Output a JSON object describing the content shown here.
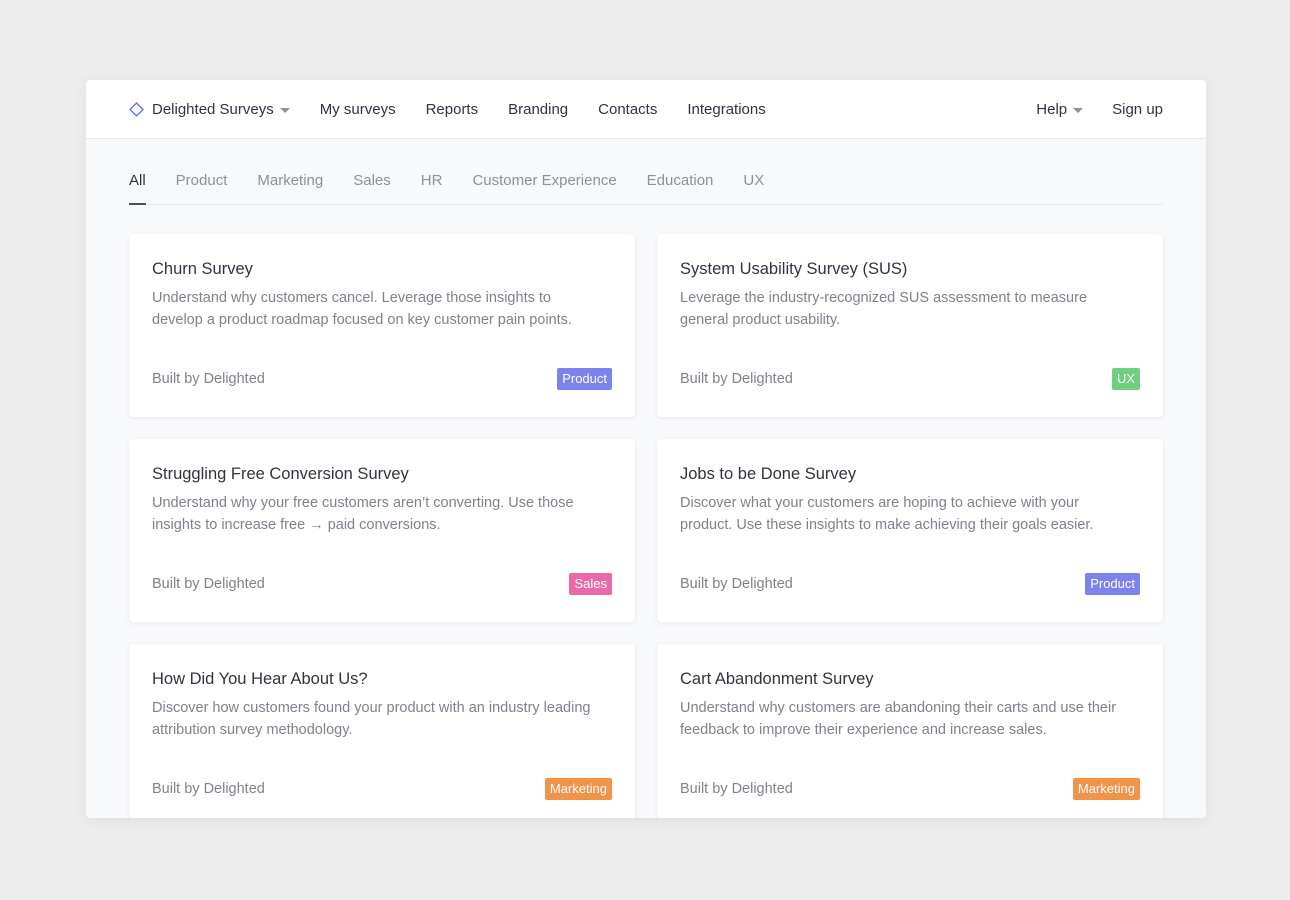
{
  "nav": {
    "brand": "Delighted Surveys",
    "links": [
      "My surveys",
      "Reports",
      "Branding",
      "Contacts",
      "Integrations"
    ],
    "help": "Help",
    "signup": "Sign up",
    "brand_icon": "diamond-icon",
    "accent": "#5b6ef5"
  },
  "tabs": [
    "All",
    "Product",
    "Marketing",
    "Sales",
    "HR",
    "Customer Experience",
    "Education",
    "UX"
  ],
  "active_tab": "All",
  "cards": [
    {
      "title": "Churn Survey",
      "description": "Understand why customers cancel. Leverage those insights to develop a product roadmap focused on key customer pain points.",
      "author": "Built by Delighted",
      "tag": "Product",
      "tag_color": "#7c83ef"
    },
    {
      "title": "System Usability Survey (SUS)",
      "description": "Leverage the industry-recognized SUS assessment to measure general product usability.",
      "author": "Built by Delighted",
      "tag": "UX",
      "tag_color": "#6fcf7c"
    },
    {
      "title": "Struggling Free Conversion Survey",
      "description": "Understand why your free customers aren’t converting. Use those insights to increase free → paid conversions.",
      "author": "Built by Delighted",
      "tag": "Sales",
      "tag_color": "#e96aa6"
    },
    {
      "title": "Jobs to be Done Survey",
      "description": "Discover what your customers are hoping to achieve with your product. Use these insights to make achieving their goals easier.",
      "author": "Built by Delighted",
      "tag": "Product",
      "tag_color": "#7c83ef"
    },
    {
      "title": "How Did You Hear About Us?",
      "description": "Discover how customers found your product with an industry leading attribution survey methodology.",
      "author": "Built by Delighted",
      "tag": "Marketing",
      "tag_color": "#f0944a"
    },
    {
      "title": "Cart Abandonment Survey",
      "description": "Understand why customers are abandoning their carts and use their feedback to improve their experience and increase sales.",
      "author": "Built by Delighted",
      "tag": "Marketing",
      "tag_color": "#f0944a"
    }
  ]
}
